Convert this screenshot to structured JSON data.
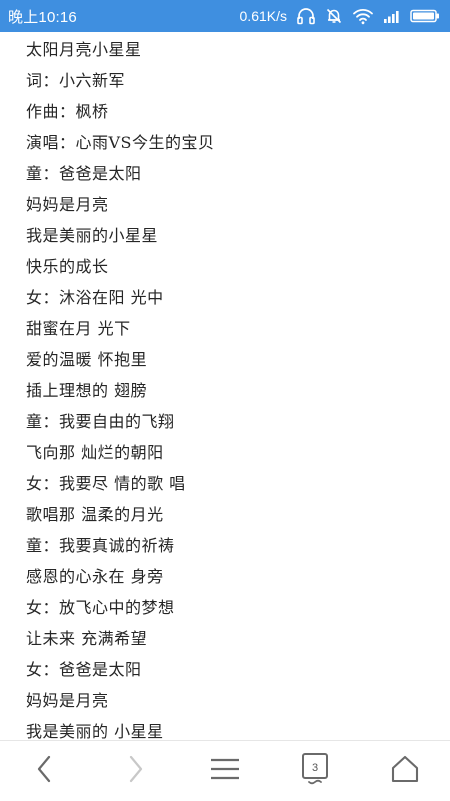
{
  "status_bar": {
    "time": "晚上10:16",
    "net_speed": "0.61K/s",
    "colors": {
      "background": "#3f8fe0",
      "foreground": "#ffffff"
    },
    "icons": [
      "headphones-icon",
      "notifications-off-icon",
      "wifi-icon",
      "signal-icon",
      "battery-icon"
    ]
  },
  "lyrics": [
    "太阳月亮小星星",
    "词：小六新军",
    "作曲：枫桥",
    "演唱：心雨VS今生的宝贝",
    "童：爸爸是太阳",
    "妈妈是月亮",
    "我是美丽的小星星",
    "快乐的成长",
    "女：沐浴在阳 光中",
    "甜蜜在月 光下",
    "爱的温暖 怀抱里",
    "插上理想的 翅膀",
    "童：我要自由的飞翔",
    "飞向那 灿烂的朝阳",
    "女：我要尽 情的歌 唱",
    "歌唱那 温柔的月光",
    "童：我要真诚的祈祷",
    "感恩的心永在 身旁",
    "女：放飞心中的梦想",
    "让未来 充满希望",
    "女：爸爸是太阳",
    "妈妈是月亮",
    "我是美丽的 小星星"
  ],
  "bottom_nav": {
    "tab_count": "3",
    "icons": [
      "back-icon",
      "forward-icon",
      "menu-icon",
      "tabs-icon",
      "home-icon"
    ]
  }
}
